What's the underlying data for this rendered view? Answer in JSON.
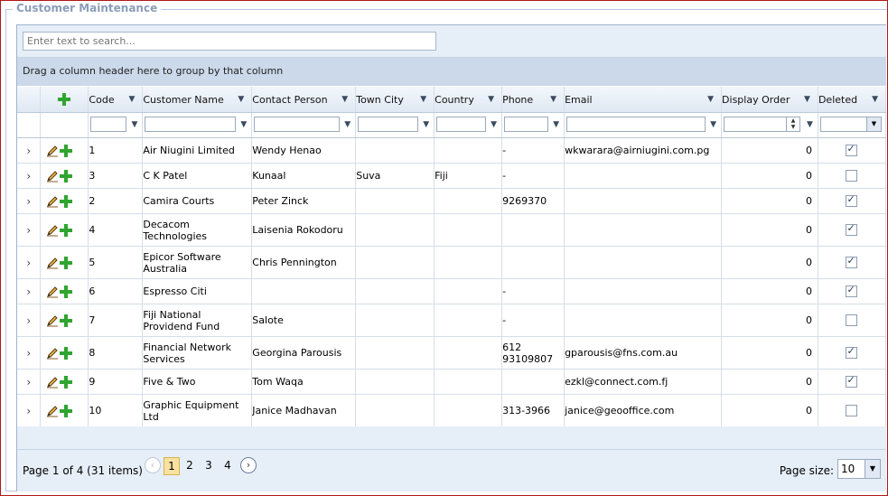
{
  "panel": {
    "title": "Customer Maintenance"
  },
  "search": {
    "placeholder": "Enter text to search..."
  },
  "group_panel": {
    "text": "Drag a column header here to group by that column"
  },
  "columns": [
    "Code",
    "Customer Name",
    "Contact Person",
    "Town City",
    "Country",
    "Phone",
    "Email",
    "Display Order",
    "Deleted"
  ],
  "rows": [
    {
      "code": "1",
      "name": "Air Niugini Limited",
      "contact": "Wendy Henao",
      "town": "",
      "country": "",
      "phone": "-",
      "email": "wkwarara@airniugini.com.pg",
      "order": "0",
      "deleted": true
    },
    {
      "code": "3",
      "name": "C K Patel",
      "contact": "Kunaal",
      "town": "Suva",
      "country": "Fiji",
      "phone": "-",
      "email": "",
      "order": "0",
      "deleted": false
    },
    {
      "code": "2",
      "name": "Camira Courts",
      "contact": "Peter Zinck",
      "town": "",
      "country": "",
      "phone": "9269370",
      "email": "",
      "order": "0",
      "deleted": true
    },
    {
      "code": "4",
      "name": "Decacom Technologies",
      "contact": "Laisenia Rokodoru",
      "town": "",
      "country": "",
      "phone": "",
      "email": "",
      "order": "0",
      "deleted": true
    },
    {
      "code": "5",
      "name": "Epicor Software Australia",
      "contact": "Chris Pennington",
      "town": "",
      "country": "",
      "phone": "",
      "email": "",
      "order": "0",
      "deleted": true
    },
    {
      "code": "6",
      "name": "Espresso Citi",
      "contact": "",
      "town": "",
      "country": "",
      "phone": "-",
      "email": "",
      "order": "0",
      "deleted": true
    },
    {
      "code": "7",
      "name": "Fiji National Providend Fund",
      "contact": "Salote",
      "town": "",
      "country": "",
      "phone": "-",
      "email": "",
      "order": "0",
      "deleted": false
    },
    {
      "code": "8",
      "name": "Financial Network Services",
      "contact": "Georgina Parousis",
      "town": "",
      "country": "",
      "phone": "612 93109807",
      "email": "gparousis@fns.com.au",
      "order": "0",
      "deleted": true
    },
    {
      "code": "9",
      "name": "Five & Two",
      "contact": "Tom Waqa",
      "town": "",
      "country": "",
      "phone": "",
      "email": "ezkl@connect.com.fj",
      "order": "0",
      "deleted": true
    },
    {
      "code": "10",
      "name": "Graphic Equipment Ltd",
      "contact": "Janice Madhavan",
      "town": "",
      "country": "",
      "phone": "313-3966",
      "email": "janice@geooffice.com",
      "order": "0",
      "deleted": false
    }
  ],
  "pager": {
    "info": "Page 1 of 4 (31 items)",
    "pages": [
      "1",
      "2",
      "3",
      "4"
    ],
    "current": "1",
    "page_size_label": "Page size:",
    "page_size": "10"
  },
  "icons": {
    "add": "plus-icon",
    "edit": "pencil-icon",
    "filter": "filter-icon",
    "expand": "chevron-right-icon"
  },
  "colors": {
    "accent": "#2fa52f",
    "header": "#dfe8f3",
    "border": "#b01818"
  }
}
